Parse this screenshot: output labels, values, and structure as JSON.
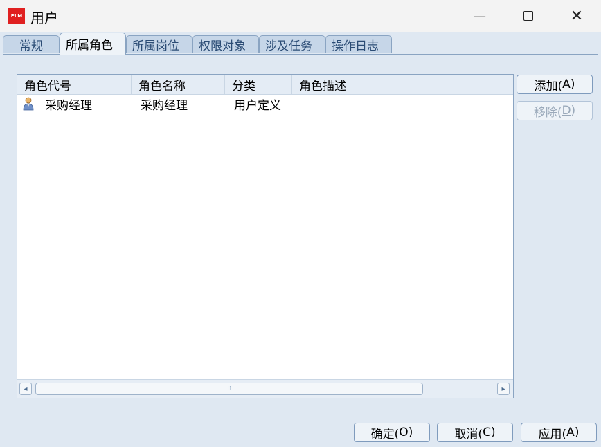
{
  "window": {
    "icon_label": "PLM",
    "title": "用户",
    "min_symbol": "—",
    "close_symbol": "✕"
  },
  "tabs": [
    {
      "label": "常规",
      "active": false
    },
    {
      "label": "所属角色",
      "active": true
    },
    {
      "label": "所属岗位",
      "active": false
    },
    {
      "label": "权限对象",
      "active": false
    },
    {
      "label": "涉及任务",
      "active": false
    },
    {
      "label": "操作日志",
      "active": false
    }
  ],
  "table": {
    "columns": [
      "角色代号",
      "角色名称",
      "分类",
      "角色描述"
    ],
    "rows": [
      {
        "code": "采购经理",
        "name": "采购经理",
        "category": "用户定义",
        "description": ""
      }
    ]
  },
  "scrollbar": {
    "left_arrow": "◂",
    "right_arrow": "▸",
    "grip": "⁞⁞"
  },
  "side_buttons": {
    "add_label": "添加(",
    "add_key": "A",
    "add_suffix": ")",
    "remove_label": "移除(",
    "remove_key": "D",
    "remove_suffix": ")"
  },
  "bottom_buttons": {
    "ok_label": "确定(",
    "ok_key": "O",
    "ok_suffix": ")",
    "cancel_label": "取消(",
    "cancel_key": "C",
    "cancel_suffix": ")",
    "apply_label": "应用(",
    "apply_key": "A",
    "apply_suffix": ")"
  },
  "colors": {
    "app_icon": "#e02020",
    "dialog_bg": "#dfe8f2",
    "tab_border": "#8aa4c2"
  }
}
